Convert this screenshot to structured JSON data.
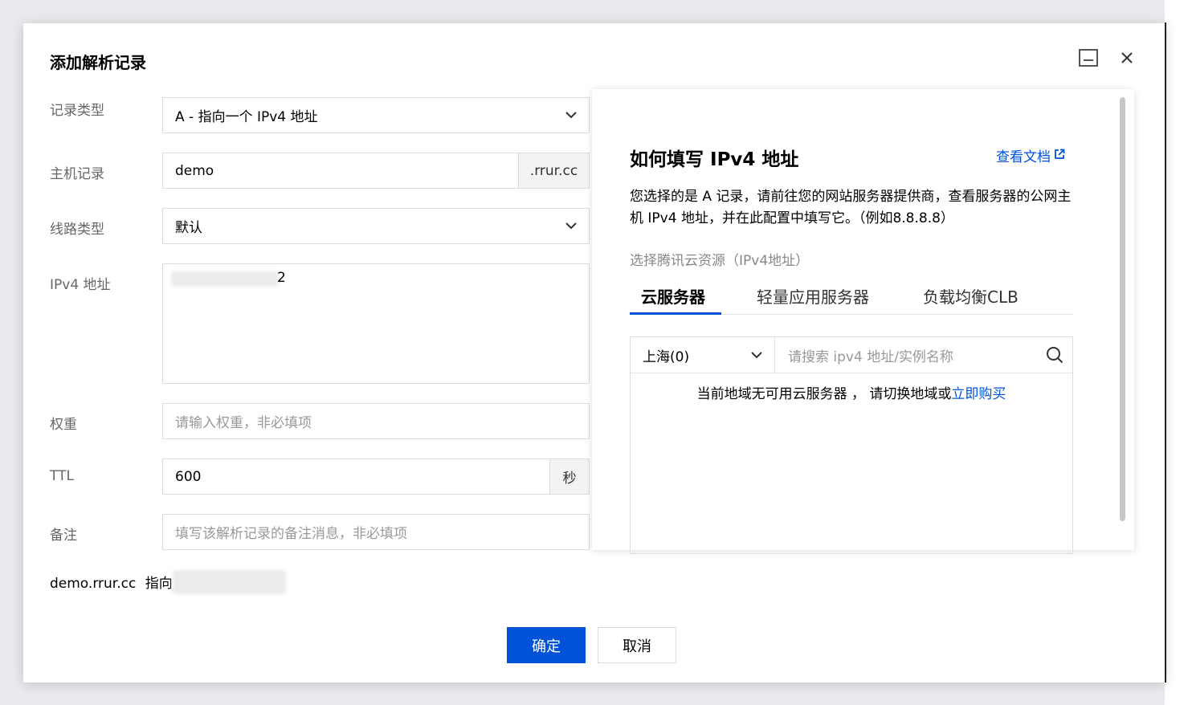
{
  "dialog": {
    "title": "添加解析记录"
  },
  "form": {
    "record_type": {
      "label": "记录类型",
      "value": "A - 指向一个 IPv4 地址"
    },
    "host": {
      "label": "主机记录",
      "value": "demo",
      "suffix": ".rrur.cc"
    },
    "line": {
      "label": "线路类型",
      "value": "默认"
    },
    "ipv4": {
      "label": "IPv4 地址",
      "tail_char": "2"
    },
    "weight": {
      "label": "权重",
      "placeholder": "请输入权重，非必填项"
    },
    "ttl": {
      "label": "TTL",
      "value": "600",
      "unit": "秒"
    },
    "note": {
      "label": "备注",
      "placeholder": "填写该解析记录的备注消息，非必填项"
    }
  },
  "preview": {
    "domain": "demo.rrur.cc",
    "points_to": "指向"
  },
  "buttons": {
    "confirm": "确定",
    "cancel": "取消"
  },
  "help": {
    "title": "如何填写 IPv4 地址",
    "doc_link": "查看文档",
    "description": "您选择的是 A 记录，请前往您的网站服务器提供商，查看服务器的公网主机 IPv4 地址，并在此配置中填写它。（例如8.8.8.8）",
    "resource_label": "选择腾讯云资源（IPv4地址）",
    "tabs": [
      "云服务器",
      "轻量应用服务器",
      "负载均衡CLB"
    ],
    "region": "上海(0)",
    "search_placeholder": "请搜索 ipv4 地址/实例名称",
    "empty_text": "当前地域无可用云服务器 ，  请切换地域或",
    "empty_link": "立即购买"
  },
  "colors": {
    "primary": "#0052d9",
    "border": "#dcdcdc",
    "label": "#666666"
  }
}
